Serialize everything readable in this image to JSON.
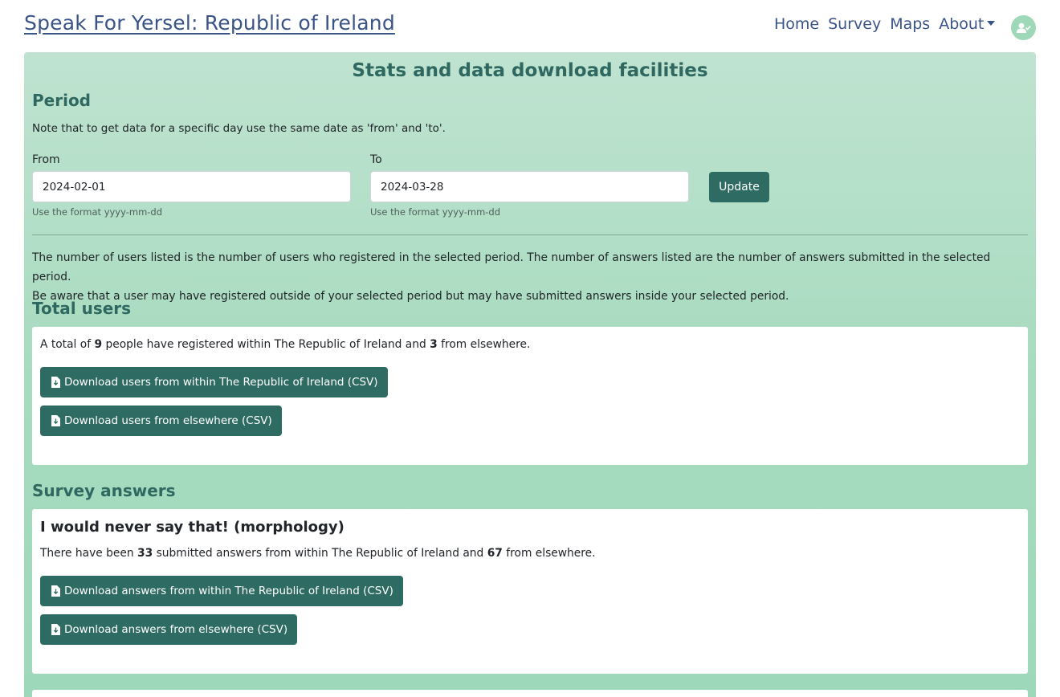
{
  "header": {
    "brand": "Speak For Yersel: Republic of Ireland",
    "nav": [
      {
        "label": "Home"
      },
      {
        "label": "Survey"
      },
      {
        "label": "Maps"
      },
      {
        "label": "About"
      }
    ],
    "avatar_icon": "user-check-icon"
  },
  "main": {
    "title": "Stats and data download facilities",
    "period": {
      "heading": "Period",
      "note": "Note that to get data for a specific day use the same date as 'from' and 'to'.",
      "from_label": "From",
      "from_value": "2024-02-01",
      "from_hint": "Use the format yyyy-mm-dd",
      "to_label": "To",
      "to_value": "2024-03-28",
      "to_hint": "Use the format yyyy-mm-dd",
      "update_label": "Update"
    },
    "info_line1": "The number of users listed is the number of users who registered in the selected period. The number of answers listed are the number of answers submitted in the selected period.",
    "info_line2": "Be aware that a user may have registered outside of your selected period but may have submitted answers inside your selected period.",
    "total_users": {
      "heading": "Total users",
      "text_prefix": "A total of ",
      "within_count": "9",
      "text_middle": " people have registered within The Republic of Ireland and ",
      "elsewhere_count": "3",
      "text_suffix": " from elsewhere.",
      "btn_within": "Download users from within The Republic of Ireland (CSV)",
      "btn_elsewhere": "Download users from elsewhere (CSV)"
    },
    "survey_answers": {
      "heading": "Survey answers",
      "survey_title": "I would never say that! (morphology)",
      "text_prefix": "There have been ",
      "within_count": "33",
      "text_middle": " submitted answers from within The Republic of Ireland and ",
      "elsewhere_count": "67",
      "text_suffix": " from elsewhere.",
      "btn_within": "Download answers from within The Republic of Ireland (CSV)",
      "btn_elsewhere": "Download answers from elsewhere (CSV)"
    }
  },
  "colors": {
    "brand_blue": "#3a5488",
    "heading_teal": "#2e6860",
    "button_teal": "#2e6b63",
    "panel_green": "#a7dbbf"
  }
}
